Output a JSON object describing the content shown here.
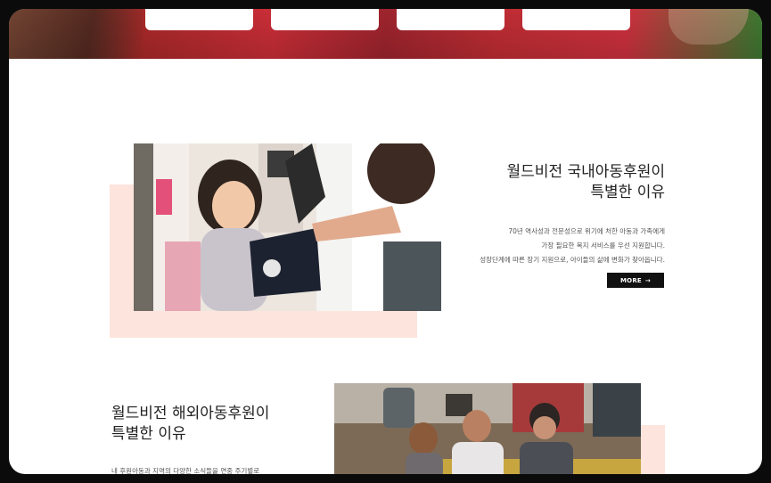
{
  "colors": {
    "accent_pink": "#fde4dc",
    "button_bg": "#111111",
    "button_text": "#ffffff",
    "title_text": "#222222",
    "body_text": "#555555"
  },
  "hero": {
    "image_desc": "red-shirt-children-banner",
    "tabs": [
      "",
      "",
      "",
      ""
    ]
  },
  "section_domestic": {
    "title_line1": "월드비전 국내아동후원이",
    "title_line2": "특별한 이유",
    "desc_line1": "70년 역사성과 전문성으로 위기에 처한 아동과 가족에게",
    "desc_line2": "가장 필요한 복지 서비스를 우선 지원합니다.",
    "desc_line3": "성장단계에 따른 장기 지원으로, 아이들의 삶에 변화가 찾아옵니다.",
    "more_label": "MORE",
    "more_icon": "arrow-right-icon"
  },
  "section_overseas": {
    "title_line1": "월드비전 해외아동후원이",
    "title_line2": "특별한 이유",
    "desc_line1": "내 후원아동과 지역의 다양한 소식들을 연중 주기별로"
  }
}
